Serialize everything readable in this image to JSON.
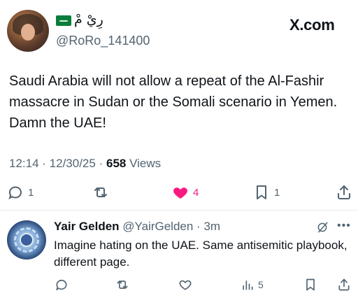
{
  "post": {
    "display_name": "رِيْ مْ",
    "handle": "@RoRo_141400",
    "watermark": "X.com",
    "text": "Saudi Arabia will not allow a repeat of the Al-Fashir massacre in Sudan or the Somali scenario in Yemen. Damn the UAE!",
    "time": "12:14",
    "date": "12/30/25",
    "views_count": "658",
    "views_label": "Views",
    "flag_icon": "saudi-flag-icon",
    "actions": {
      "replies": "1",
      "reposts": "",
      "likes": "4",
      "bookmarks": "1"
    },
    "like_color": "#f91880"
  },
  "reply": {
    "name": "Yair Gelden",
    "handle": "@YairGelden",
    "time": "3m",
    "text": "Imagine hating on the UAE. Same antisemitic playbook, different page.",
    "views": "5"
  }
}
